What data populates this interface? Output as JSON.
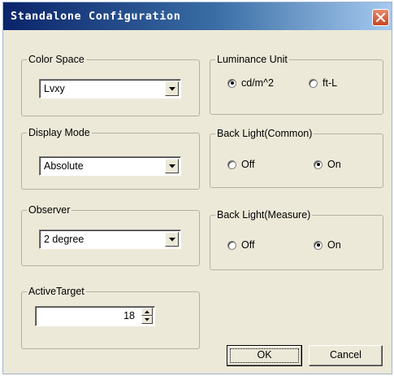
{
  "window": {
    "title": "Standalone Configuration",
    "close_icon": "close-icon",
    "colors": {
      "title_start": "#0a246a",
      "title_end": "#a6caf0",
      "close": "#d95b36",
      "face": "#ece9d8"
    }
  },
  "color_space": {
    "label": "Color Space",
    "value": "Lvxy"
  },
  "display_mode": {
    "label": "Display Mode",
    "value": "Absolute"
  },
  "observer": {
    "label": "Observer",
    "value": "2 degree"
  },
  "active_target": {
    "label": "ActiveTarget",
    "value": "18"
  },
  "luminance_unit": {
    "label": "Luminance Unit",
    "options": [
      {
        "label": "cd/m^2",
        "checked": true
      },
      {
        "label": "ft-L",
        "checked": false
      }
    ]
  },
  "back_light_common": {
    "label": "Back Light(Common)",
    "options": [
      {
        "label": "Off",
        "checked": false
      },
      {
        "label": "On",
        "checked": true
      }
    ]
  },
  "back_light_measure": {
    "label": "Back Light(Measure)",
    "options": [
      {
        "label": "Off",
        "checked": false
      },
      {
        "label": "On",
        "checked": true
      }
    ]
  },
  "buttons": {
    "ok": "OK",
    "cancel": "Cancel"
  }
}
